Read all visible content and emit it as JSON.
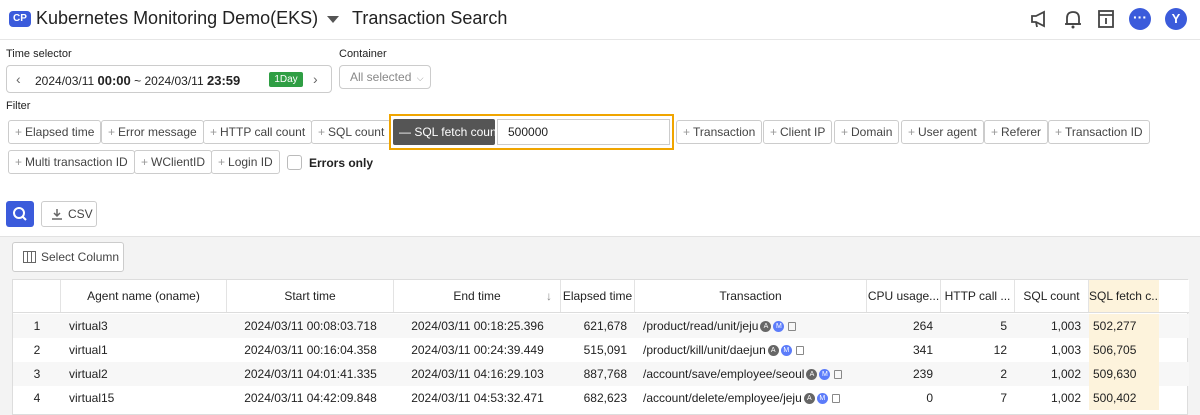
{
  "header": {
    "badge": "CP",
    "project": "Kubernetes Monitoring Demo(EKS)",
    "title": "Transaction Search",
    "avatar": "Y"
  },
  "time_selector": {
    "label": "Time selector",
    "start_date": "2024/03/11",
    "start_time": "00:00",
    "separator": "~",
    "end_date": "2024/03/11",
    "end_time": "23:59",
    "range_badge": "1Day"
  },
  "container": {
    "label": "Container",
    "value": "All selected"
  },
  "filter": {
    "label": "Filter",
    "row1_left": [
      "Elapsed time",
      "Error message",
      "HTTP call count",
      "SQL count"
    ],
    "active": {
      "label": "SQL fetch count",
      "value": "500000"
    },
    "row1_right": [
      "Transaction",
      "Client IP",
      "Domain",
      "User agent",
      "Referer",
      "Transaction ID"
    ],
    "row2": [
      "Multi transaction ID",
      "WClientID",
      "Login ID"
    ],
    "errors_only": "Errors only"
  },
  "actions": {
    "csv": "CSV",
    "select_column": "Select Column"
  },
  "table": {
    "columns": [
      "",
      "Agent name (oname)",
      "Start time",
      "End time",
      "Elapsed time",
      "Transaction",
      "CPU usage...",
      "HTTP call ...",
      "SQL count",
      "SQL fetch c..."
    ],
    "rows": [
      {
        "idx": "1",
        "agent": "virtual3",
        "start": "2024/03/11 00:08:03.718",
        "end": "2024/03/11 00:18:25.396",
        "elapsed": "621,678",
        "tx": "/product/read/unit/jeju",
        "cpu": "264",
        "http": "5",
        "sql": "1,003",
        "fetch": "502,277"
      },
      {
        "idx": "2",
        "agent": "virtual1",
        "start": "2024/03/11 00:16:04.358",
        "end": "2024/03/11 00:24:39.449",
        "elapsed": "515,091",
        "tx": "/product/kill/unit/daejun",
        "cpu": "341",
        "http": "12",
        "sql": "1,003",
        "fetch": "506,705"
      },
      {
        "idx": "3",
        "agent": "virtual2",
        "start": "2024/03/11 04:01:41.335",
        "end": "2024/03/11 04:16:29.103",
        "elapsed": "887,768",
        "tx": "/account/save/employee/seoul",
        "cpu": "239",
        "http": "2",
        "sql": "1,002",
        "fetch": "509,630"
      },
      {
        "idx": "4",
        "agent": "virtual15",
        "start": "2024/03/11 04:42:09.848",
        "end": "2024/03/11 04:53:32.471",
        "elapsed": "682,623",
        "tx": "/account/delete/employee/jeju",
        "cpu": "0",
        "http": "7",
        "sql": "1,002",
        "fetch": "500,402"
      }
    ],
    "tx_badges": [
      "A",
      "M"
    ]
  },
  "colors": {
    "accent": "#3b5bdb",
    "highlight": "#fdf3dc",
    "active_border": "#f0a500",
    "badge_green": "#2f9e44"
  }
}
